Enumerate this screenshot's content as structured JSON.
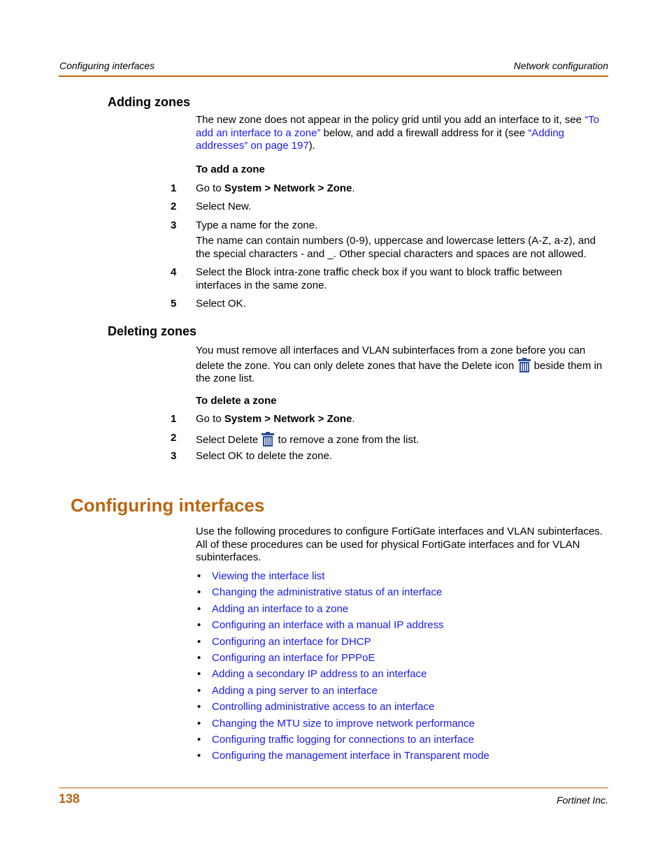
{
  "header": {
    "left": "Configuring interfaces",
    "right": "Network configuration"
  },
  "adding_zones": {
    "heading": "Adding zones",
    "intro": {
      "t1": "The new zone does not appear in the policy grid until you add an interface to it, see ",
      "link1": "“To add an interface to a zone”",
      "t2": " below, and add a firewall address for it (see ",
      "link2": "“Adding addresses” on page 197",
      "t3": ")."
    },
    "procedure_title": "To add a zone",
    "steps": [
      {
        "num": "1",
        "pre": "Go to ",
        "bold": "System > Network > Zone",
        "post": "."
      },
      {
        "num": "2",
        "text": "Select New."
      },
      {
        "num": "3",
        "text": "Type a name for the zone.",
        "note": "The name can contain numbers (0-9), uppercase and lowercase letters (A-Z, a-z), and the special characters - and _. Other special characters and spaces are not allowed."
      },
      {
        "num": "4",
        "text": "Select the Block intra-zone traffic check box if you want to block traffic between interfaces in the same zone."
      },
      {
        "num": "5",
        "text": "Select OK."
      }
    ]
  },
  "deleting_zones": {
    "heading": "Deleting zones",
    "intro": {
      "t1": "You must remove all interfaces and VLAN subinterfaces from a zone before you can delete the zone. You can only delete zones that have the Delete icon ",
      "icon": "trash-icon",
      "t2": " beside them in the zone list."
    },
    "procedure_title": "To delete a zone",
    "steps": [
      {
        "num": "1",
        "pre": "Go to ",
        "bold": "System > Network > Zone",
        "post": "."
      },
      {
        "num": "2",
        "pre": "Select Delete ",
        "icon": "trash-icon",
        "post": " to remove a zone from the list."
      },
      {
        "num": "3",
        "text": "Select OK to delete the zone."
      }
    ]
  },
  "configuring_interfaces": {
    "heading": "Configuring interfaces",
    "intro": "Use the following procedures to configure FortiGate interfaces and VLAN subinterfaces. All of these procedures can be used for physical FortiGate interfaces and for VLAN subinterfaces.",
    "bullet_char": "•",
    "links": [
      "Viewing the interface list",
      "Changing the administrative status of an interface",
      "Adding an interface to a zone",
      "Configuring an interface with a manual IP address",
      "Configuring an interface for DHCP",
      "Configuring an interface for PPPoE",
      "Adding a secondary IP address to an interface",
      "Adding a ping server to an interface",
      "Controlling administrative access to an interface",
      "Changing the MTU size to improve network performance",
      "Configuring traffic logging for connections to an interface",
      "Configuring the management interface in Transparent mode"
    ]
  },
  "footer": {
    "page_number": "138",
    "company": "Fortinet Inc."
  },
  "colors": {
    "accent": "#b8660f",
    "link": "#1a1aee",
    "icon_blue": "#2b4c9b"
  }
}
